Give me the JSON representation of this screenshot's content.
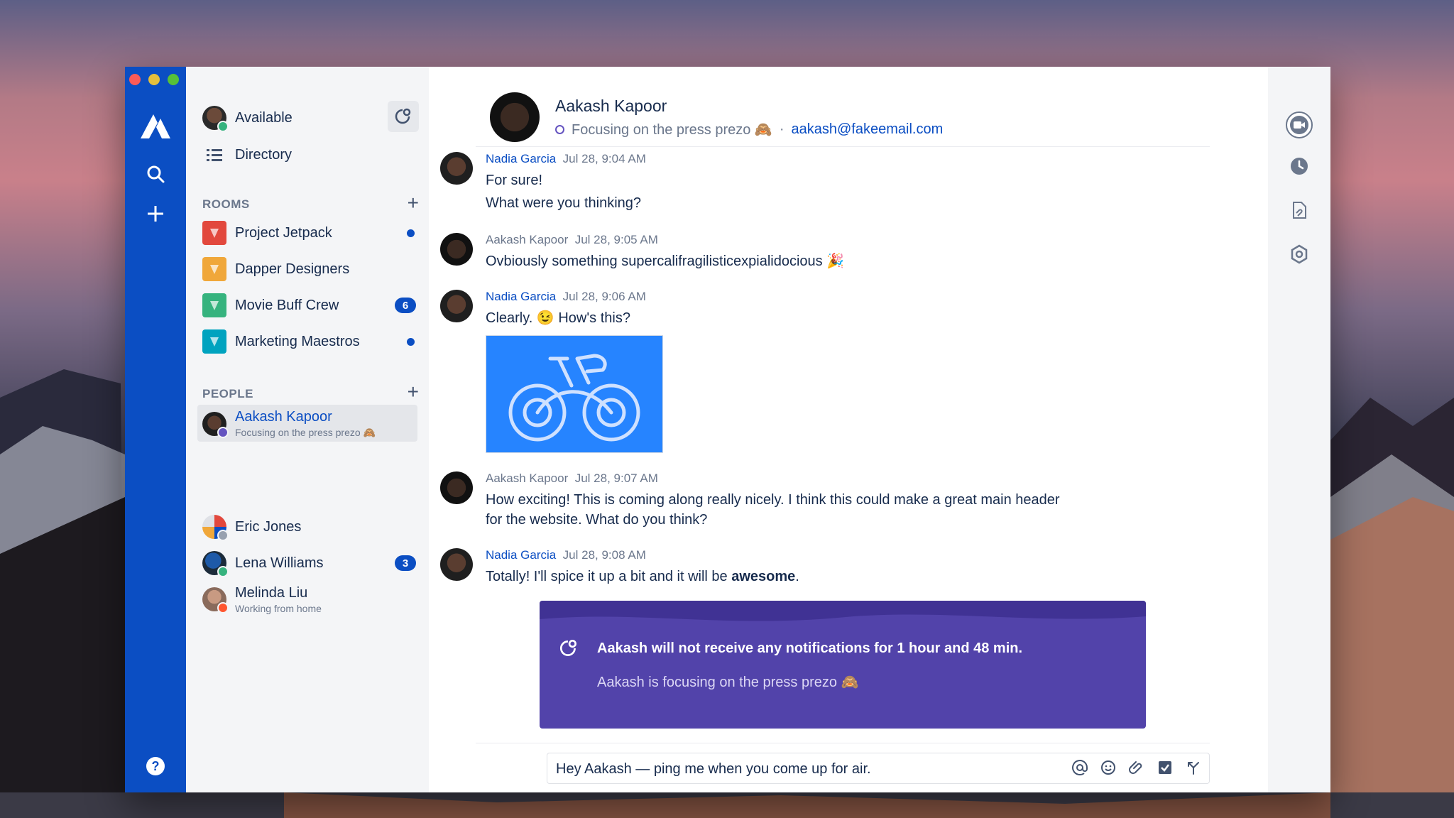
{
  "sidebar": {
    "status_label": "Available",
    "directory_label": "Directory",
    "rooms_title": "ROOMS",
    "people_title": "PEOPLE",
    "rooms": [
      {
        "name": "Project Jetpack",
        "color": "#e2483d",
        "indicator": "dot"
      },
      {
        "name": "Dapper Designers",
        "color": "#f0a73a",
        "indicator": ""
      },
      {
        "name": "Movie Buff Crew",
        "color": "#36b37e",
        "indicator": "badge",
        "count": "6"
      },
      {
        "name": "Marketing Maestros",
        "color": "#00a3bf",
        "indicator": "dot"
      }
    ],
    "people": [
      {
        "name": "Aakash Kapoor",
        "sub": "Focusing on the press prezo 🙈",
        "status_color": "#6554c0",
        "active": true
      },
      {
        "name": "Eric Jones",
        "sub": "",
        "status_color": "#97a0af"
      },
      {
        "name": "Lena Williams",
        "sub": "",
        "status_color": "#36b37e",
        "count": "3"
      },
      {
        "name": "Melinda Liu",
        "sub": "Working from home",
        "status_color": "#ff5630"
      }
    ]
  },
  "header": {
    "name": "Aakash Kapoor",
    "status": "Focusing on the press prezo 🙈",
    "separator": "·",
    "email": "aakash@fakeemail.com"
  },
  "messages": [
    {
      "author": "Nadia Garcia",
      "time": "Jul 28, 9:04 AM",
      "lines": [
        "For sure!",
        "What were you thinking?"
      ],
      "highlight": true
    },
    {
      "author": "Aakash Kapoor",
      "time": "Jul 28, 9:05 AM",
      "lines": [
        "Ovbiously something supercalifragilisticexpialidocious 🎉"
      ],
      "highlight": false
    },
    {
      "author": "Nadia Garcia",
      "time": "Jul 28, 9:06 AM",
      "lines": [
        "Clearly. 😉 How's this?"
      ],
      "highlight": true
    },
    {
      "author": "Aakash Kapoor",
      "time": "Jul 28, 9:07 AM",
      "lines": [
        "How exciting! This is coming along really nicely. I think this could make a great main header",
        "for the website. What do you think?"
      ],
      "highlight": false
    },
    {
      "author": "Nadia Garcia",
      "time": "Jul 28, 9:08 AM",
      "text_before": "Totally! I'll spice it up a bit and it will be ",
      "text_bold": "awesome",
      "text_after": ".",
      "highlight": true
    }
  ],
  "focus_banner": {
    "title": "Aakash will not receive any notifications for 1 hour and 48 min.",
    "subtitle": "Aakash is focusing on the press prezo 🙈"
  },
  "composer": {
    "value": "Hey Aakash — ping me when you come up for air."
  },
  "colors": {
    "accent": "#0b4ec3",
    "banner": "#5243aa"
  }
}
